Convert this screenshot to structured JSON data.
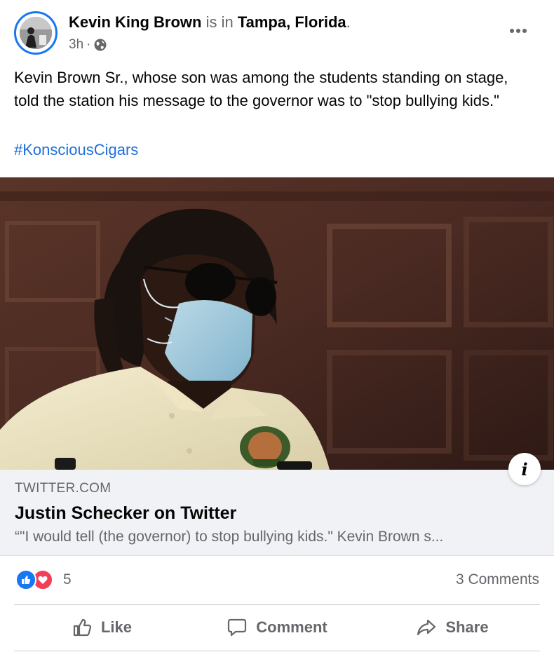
{
  "post": {
    "author": "Kevin King Brown",
    "is_in": "is in",
    "location": "Tampa, Florida",
    "location_end": ".",
    "time": "3h",
    "separator": "·",
    "privacy_icon": "globe-icon",
    "text": "Kevin Brown Sr., whose son was among the students standing on stage, told the station his message to the governor was to \"stop bullying kids.\"",
    "hashtag": "#KonsciousCigars"
  },
  "link_card": {
    "domain": "TWITTER.COM",
    "title": "Justin Schecker on Twitter",
    "description": "“\"I would tell (the governor) to stop bullying kids.\" Kevin Brown s..."
  },
  "stats": {
    "reaction_icons": [
      "like-icon",
      "love-icon"
    ],
    "reaction_count": "5",
    "comments": "3 Comments"
  },
  "actions": {
    "like": "Like",
    "comment": "Comment",
    "share": "Share"
  },
  "colors": {
    "accent": "#1877f2",
    "hashtag": "#216fdb",
    "love": "#f33e58",
    "secondary_text": "#65676b",
    "card_bg": "#f0f2f5"
  }
}
